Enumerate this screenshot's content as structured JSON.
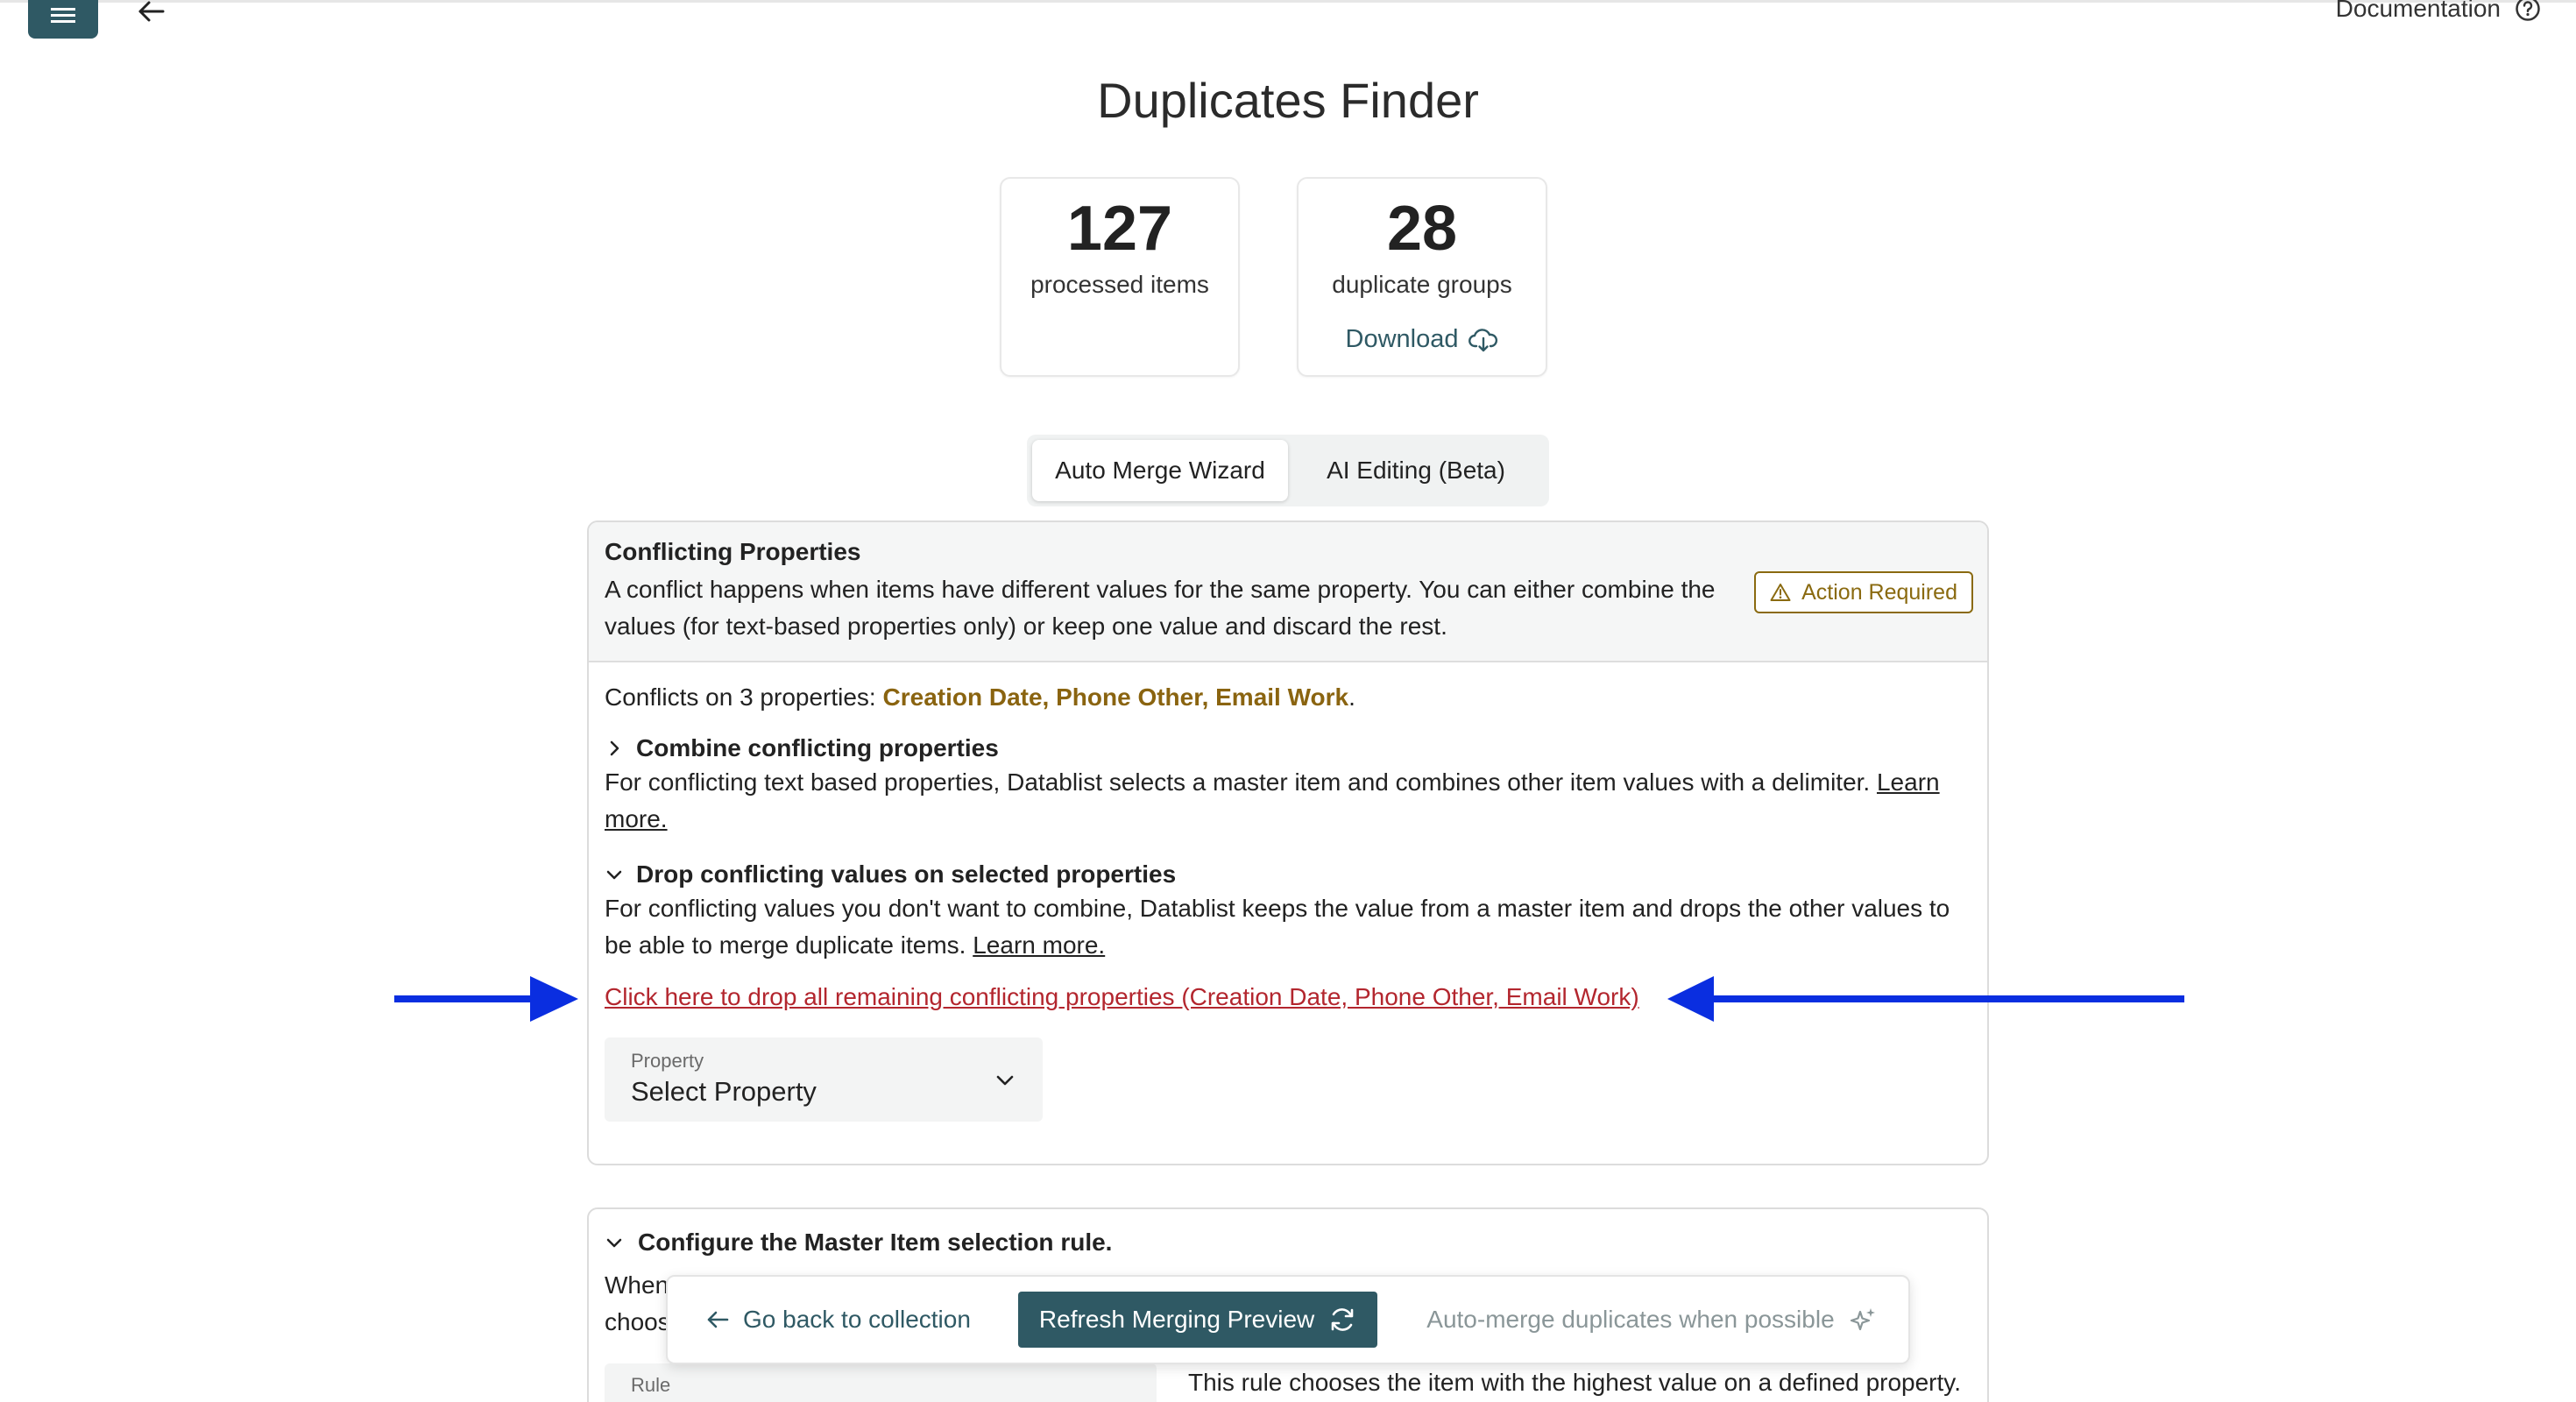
{
  "topbar": {
    "documentation_label": "Documentation"
  },
  "page": {
    "title": "Duplicates Finder"
  },
  "stats": {
    "processed_count": "127",
    "processed_label": "processed items",
    "groups_count": "28",
    "groups_label": "duplicate groups",
    "download_label": "Download"
  },
  "tabs": [
    {
      "label": "Auto Merge Wizard",
      "active": true
    },
    {
      "label": "AI Editing (Beta)",
      "active": false
    }
  ],
  "conflicts_panel": {
    "title": "Conflicting Properties",
    "description": "A conflict happens when items have different values for the same property. You can either combine the values (for text-based properties only) or keep one value and discard the rest.",
    "badge": "Action Required",
    "conflicts_prefix": "Conflicts on 3 properties: ",
    "conflicts_list": "Creation Date, Phone Other, Email Work",
    "conflicts_suffix": ".",
    "combine_title": "Combine conflicting properties",
    "combine_text": "For conflicting text based properties, Datablist selects a master item and combines other item values with a delimiter. ",
    "combine_learn": "Learn more.",
    "drop_title": "Drop conflicting values on selected properties",
    "drop_text": "For conflicting values you don't want to combine, Datablist keeps the value from a master item and drops the other values to be able to merge duplicate items. ",
    "drop_learn": "Learn more.",
    "drop_all_link": "Click here to drop all remaining conflicting properties (Creation Date, Phone Other, Email Work)",
    "property_label": "Property",
    "property_value": "Select Property"
  },
  "master_panel": {
    "title": "Configure the Master Item selection rule.",
    "text": "When merging multiple items, Datablist selects a master item and combines the values from others into it. By default, it chooses",
    "rule_label": "Rule",
    "rule_description": "This rule chooses the item with the highest value on a defined property."
  },
  "action_bar": {
    "back_label": "Go back to collection",
    "refresh_label": "Refresh Merging Preview",
    "auto_merge_label": "Auto-merge duplicates when possible"
  },
  "colors": {
    "primary": "#2f5964",
    "warning": "#8a6410",
    "link_red": "#b3262e",
    "annotation_arrow": "#0a2ee0"
  },
  "icons": [
    "menu-icon",
    "arrow-left-icon",
    "help-circle-icon",
    "cloud-download-icon",
    "warning-triangle-icon",
    "chevron-right-icon",
    "chevron-down-icon",
    "refresh-icon",
    "sparkles-icon",
    "blue-arrow-right",
    "blue-arrow-left"
  ]
}
